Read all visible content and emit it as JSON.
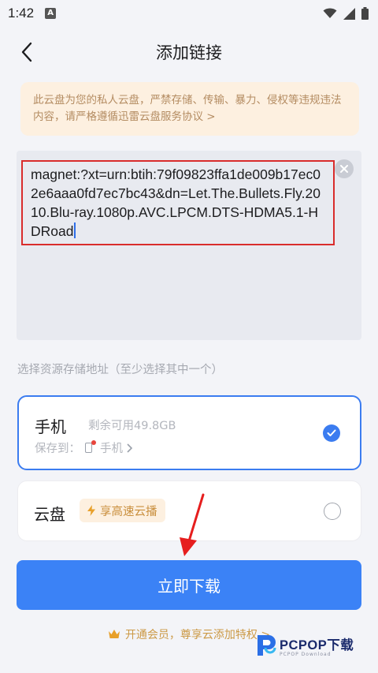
{
  "status_bar": {
    "time": "1:42",
    "app_icon": "A",
    "icons": [
      "wifi-icon",
      "signal-icon",
      "battery-icon"
    ]
  },
  "header": {
    "title": "添加链接"
  },
  "notice": {
    "text": "此云盘为您的私人云盘，严禁存储、传输、暴力、侵权等违规违法内容，请严格遵循",
    "link_label": "迅雷云盘服务协议 >"
  },
  "link_input": {
    "value": "magnet:?xt=urn:btih:79f09823ffa1de009b17ec02e6aaa0fd7ec7bc43&dn=Let.The.Bullets.Fly.2010.Blu-ray.1080p.AVC.LPCM.DTS-HDMA5.1-HDRoad"
  },
  "storage": {
    "label": "选择资源存储地址（至少选择其中一个）",
    "phone": {
      "title": "手机",
      "subtitle": "剩余可用49.8GB",
      "save_prefix": "保存到：",
      "save_target": "手机",
      "selected": true
    },
    "cloud": {
      "title": "云盘",
      "badge": "享高速云播",
      "selected": false
    }
  },
  "download_button": {
    "label": "立即下载"
  },
  "vip": {
    "text": "开通会员，尊享云添加特权 >"
  },
  "watermark": {
    "brand": "PCPOP下载",
    "sub": "PCPOP Download"
  },
  "colors": {
    "accent": "#3b82f6",
    "highlight_border": "#d92c2c",
    "notice_bg": "#fdf0e0",
    "vip_gold": "#cc9a47"
  }
}
